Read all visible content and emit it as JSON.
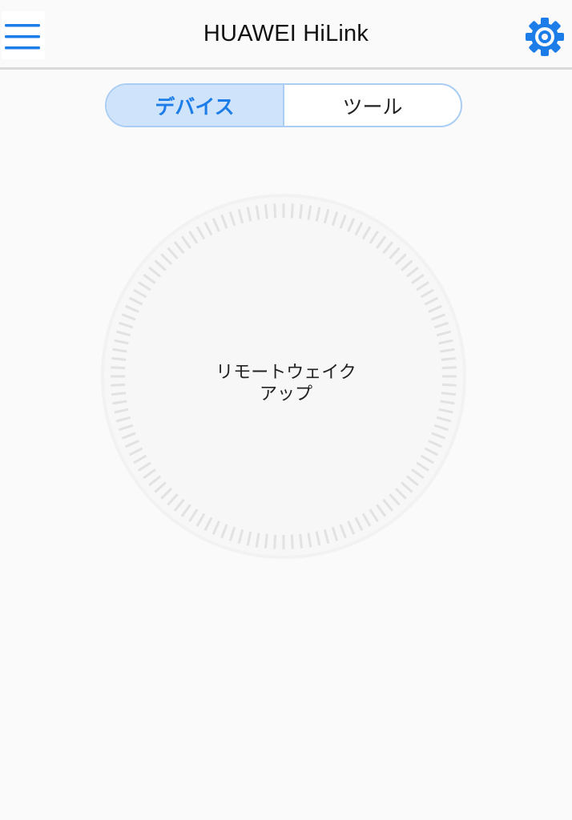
{
  "header": {
    "title": "HUAWEI HiLink",
    "menu_icon": "hamburger-menu-icon",
    "settings_icon": "gear-icon",
    "accent_color": "#1c7de8"
  },
  "tabs": [
    {
      "label": "デバイス",
      "active": true
    },
    {
      "label": "ツール",
      "active": false
    }
  ],
  "main": {
    "wake_label_line1": "リモートウェイク",
    "wake_label_line2": "アップ"
  }
}
